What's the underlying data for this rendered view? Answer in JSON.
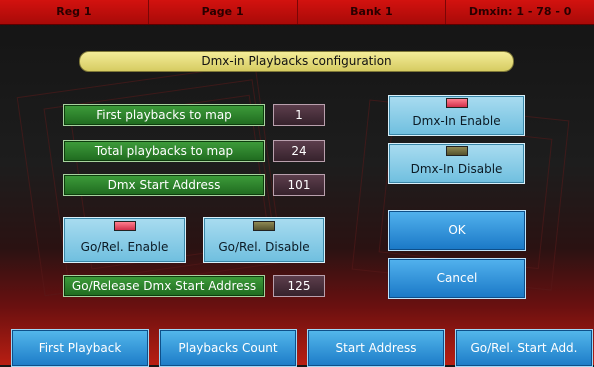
{
  "status_bar": {
    "reg": "Reg 1",
    "page": "Page 1",
    "bank": "Bank 1",
    "dmxin": "Dmxin: 1 - 78 - 0"
  },
  "dialog_title": "Dmx-in Playbacks configuration",
  "fields": {
    "first_playbacks_label": "First playbacks to map",
    "first_playbacks_value": "1",
    "total_playbacks_label": "Total playbacks to map",
    "total_playbacks_value": "24",
    "dmx_start_label": "Dmx Start Address",
    "dmx_start_value": "101",
    "gorel_start_label": "Go/Release Dmx Start Address",
    "gorel_start_value": "125"
  },
  "buttons": {
    "gorel_enable": "Go/Rel. Enable",
    "gorel_disable": "Go/Rel. Disable",
    "dmxin_enable": "Dmx-In Enable",
    "dmxin_disable": "Dmx-In Disable",
    "ok": "OK",
    "cancel": "Cancel"
  },
  "bottom_tabs": [
    "First Playback",
    "Playbacks Count",
    "Start Address",
    "Go/Rel. Start Add."
  ],
  "colors": {
    "status_bar": "#c10e0c",
    "label_green": "#2d8a2b",
    "value_maroon": "#4a3140",
    "button_teal": "#8ccfe8",
    "button_blue": "#2f93dc",
    "title_pill": "#e8df84",
    "led_on": "#e8455f",
    "led_off": "#6f6a3f"
  }
}
